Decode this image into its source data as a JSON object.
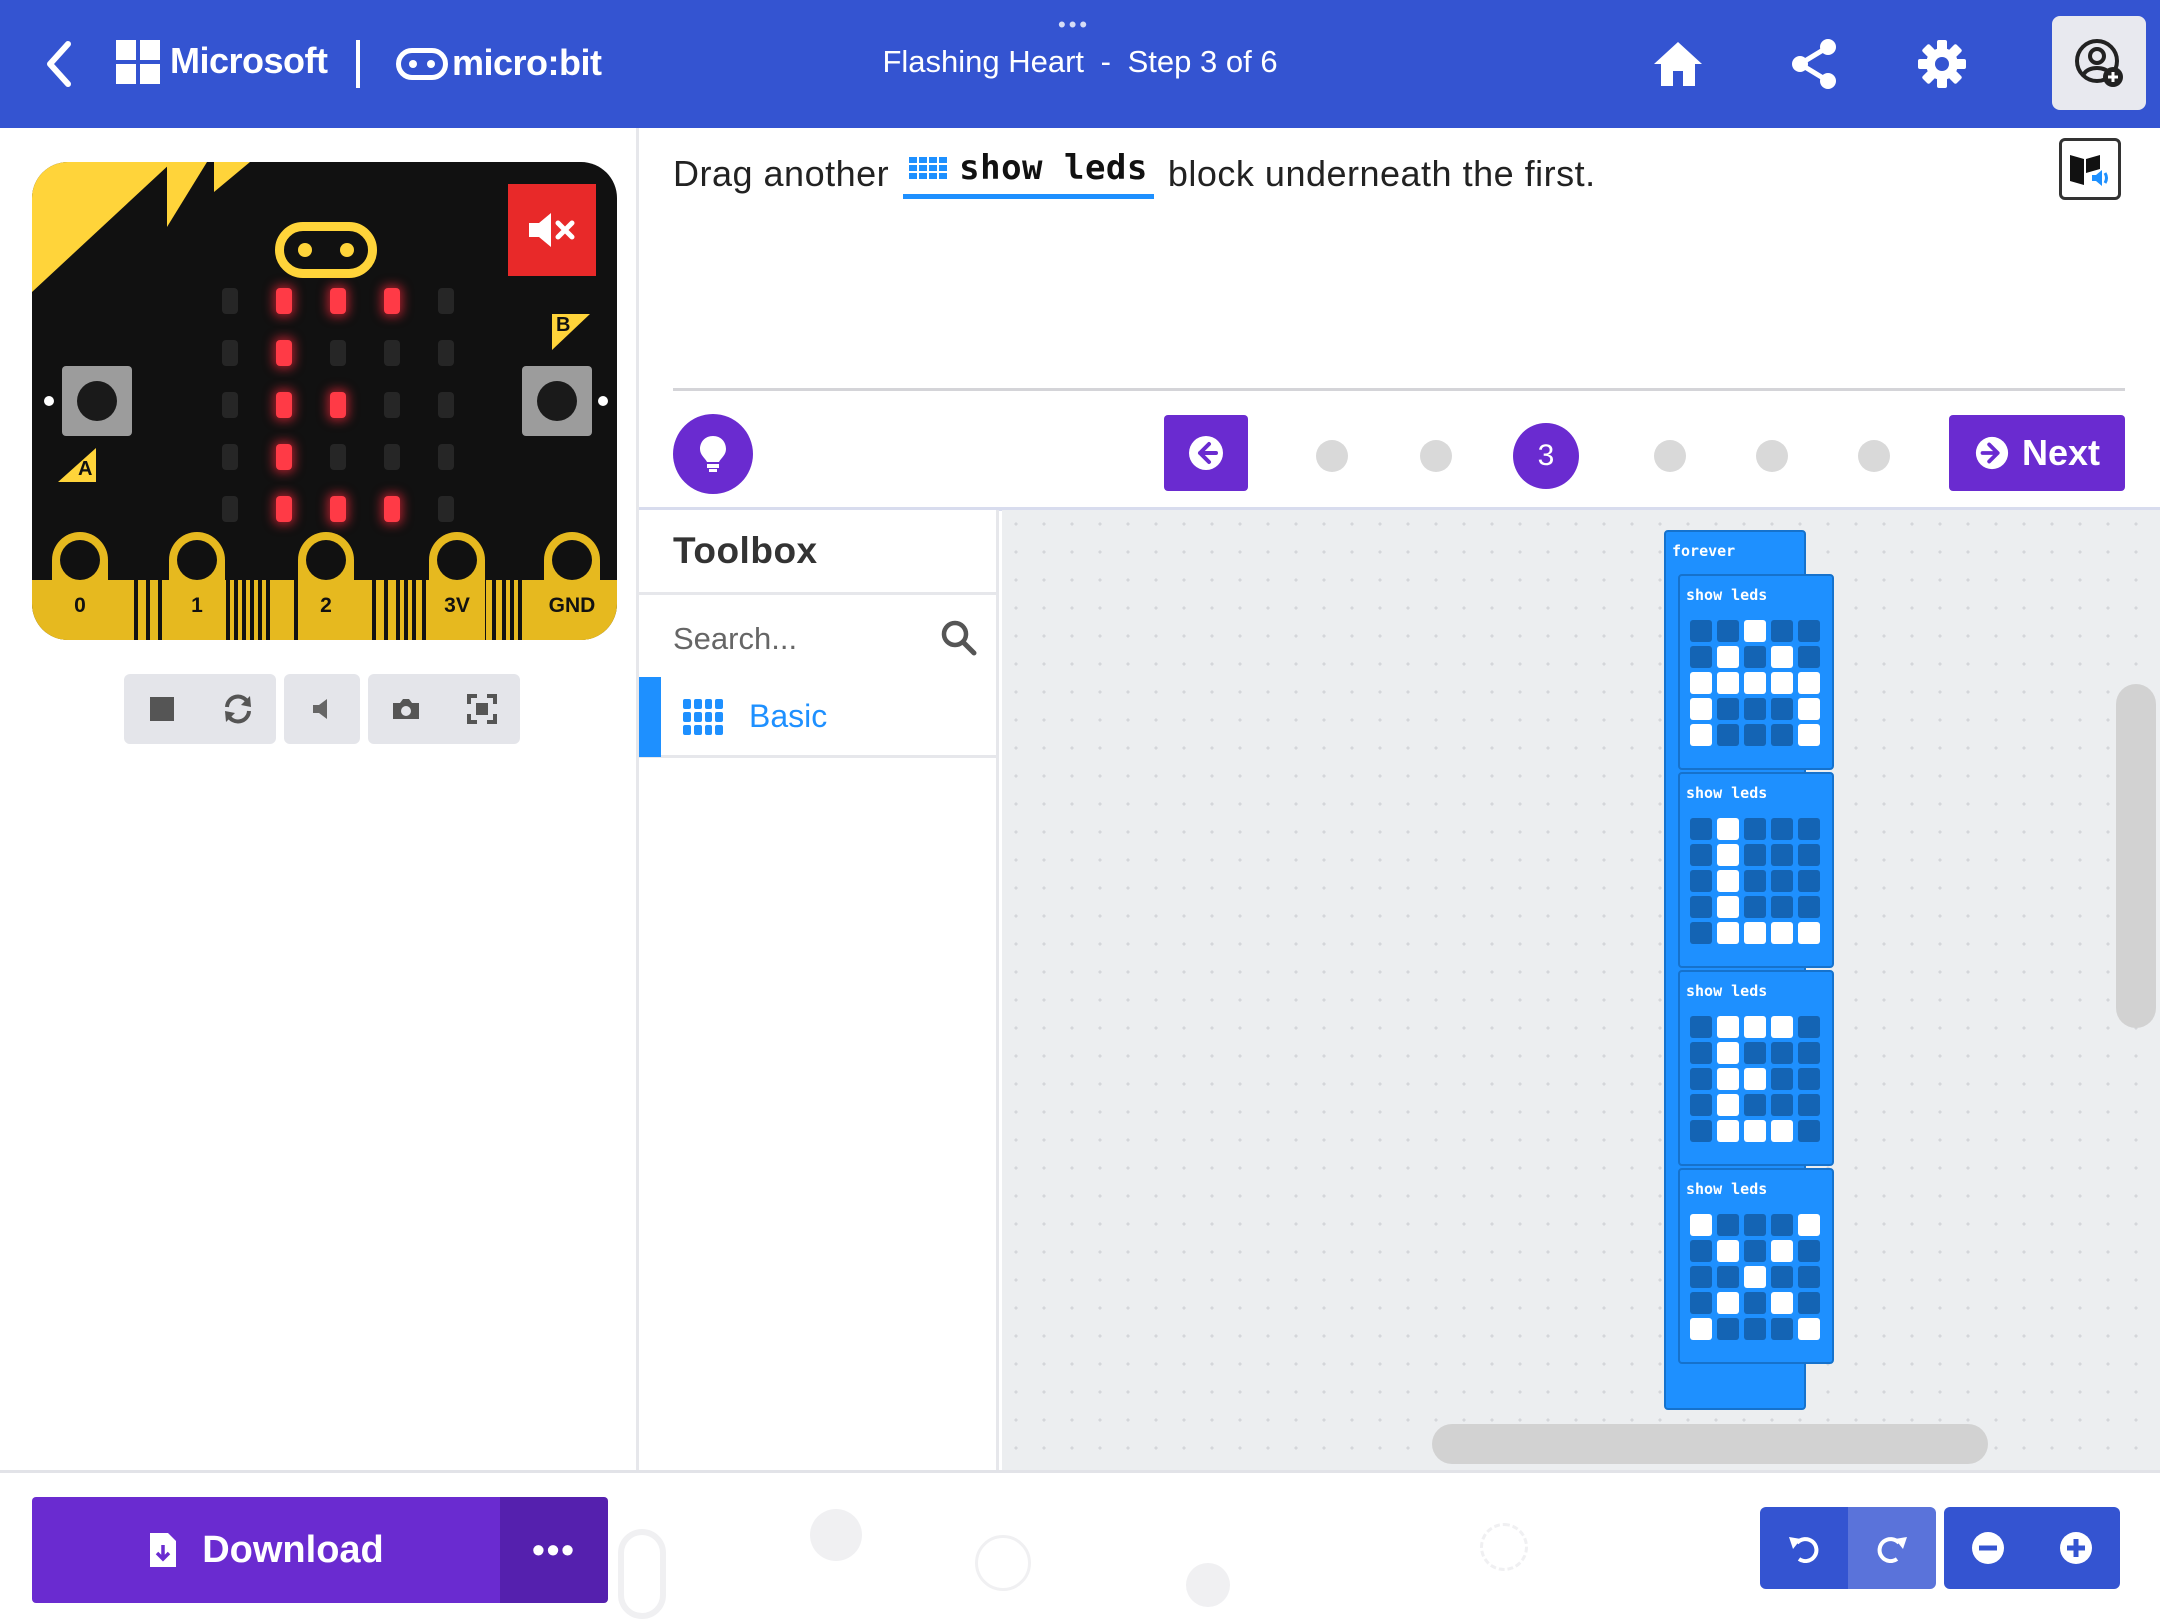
{
  "header": {
    "brand_microsoft": "Microsoft",
    "brand_microbit": "micro:bit",
    "tutorial_name": "Flashing Heart",
    "separator": "-",
    "step_text": "Step 3 of 6",
    "drag_handle": "•••",
    "icons": [
      "back-arrow",
      "home",
      "share",
      "gear",
      "sign-in-user"
    ]
  },
  "simulator": {
    "pins": [
      "0",
      "1",
      "2",
      "3V",
      "GND"
    ],
    "button_a": "A",
    "button_b": "B",
    "led_matrix_on": [
      [
        0,
        1,
        1,
        1,
        0
      ],
      [
        0,
        1,
        0,
        0,
        0
      ],
      [
        0,
        1,
        1,
        0,
        0
      ],
      [
        0,
        1,
        0,
        0,
        0
      ],
      [
        0,
        1,
        1,
        1,
        0
      ]
    ],
    "toolbar_icons": [
      "stop",
      "restart",
      "mute",
      "screenshot",
      "fullscreen"
    ]
  },
  "instructions": {
    "prefix": "Drag another",
    "block_name": "show leds",
    "suffix": "block underneath the first.",
    "current_step": "3",
    "total_steps": 6,
    "next_label": "Next"
  },
  "toolbox": {
    "title": "Toolbox",
    "search_placeholder": "Search...",
    "categories": [
      {
        "label": "Basic",
        "color": "#1e90ff"
      }
    ]
  },
  "workspace": {
    "forever_label": "forever",
    "blocks": [
      {
        "label": "show leds",
        "grid": [
          [
            0,
            0,
            1,
            0,
            0
          ],
          [
            0,
            1,
            0,
            1,
            0
          ],
          [
            1,
            1,
            1,
            1,
            1
          ],
          [
            1,
            0,
            0,
            0,
            1
          ],
          [
            1,
            0,
            0,
            0,
            1
          ]
        ]
      },
      {
        "label": "show leds",
        "grid": [
          [
            0,
            1,
            0,
            0,
            0
          ],
          [
            0,
            1,
            0,
            0,
            0
          ],
          [
            0,
            1,
            0,
            0,
            0
          ],
          [
            0,
            1,
            0,
            0,
            0
          ],
          [
            0,
            1,
            1,
            1,
            1
          ]
        ]
      },
      {
        "label": "show leds",
        "grid": [
          [
            0,
            1,
            1,
            1,
            0
          ],
          [
            0,
            1,
            0,
            0,
            0
          ],
          [
            0,
            1,
            1,
            0,
            0
          ],
          [
            0,
            1,
            0,
            0,
            0
          ],
          [
            0,
            1,
            1,
            1,
            0
          ]
        ]
      },
      {
        "label": "show leds",
        "grid": [
          [
            1,
            0,
            0,
            0,
            1
          ],
          [
            0,
            1,
            0,
            1,
            0
          ],
          [
            0,
            0,
            1,
            0,
            0
          ],
          [
            0,
            1,
            0,
            1,
            0
          ],
          [
            1,
            0,
            0,
            0,
            1
          ]
        ]
      }
    ]
  },
  "footer": {
    "download_label": "Download",
    "more_label": "•••"
  },
  "colors": {
    "header": "#3454d1",
    "accent_purple": "#6a2bd0",
    "basic_blue": "#1e90ff",
    "led_red": "#ff3a46",
    "board_yellow": "#e6b91f"
  }
}
